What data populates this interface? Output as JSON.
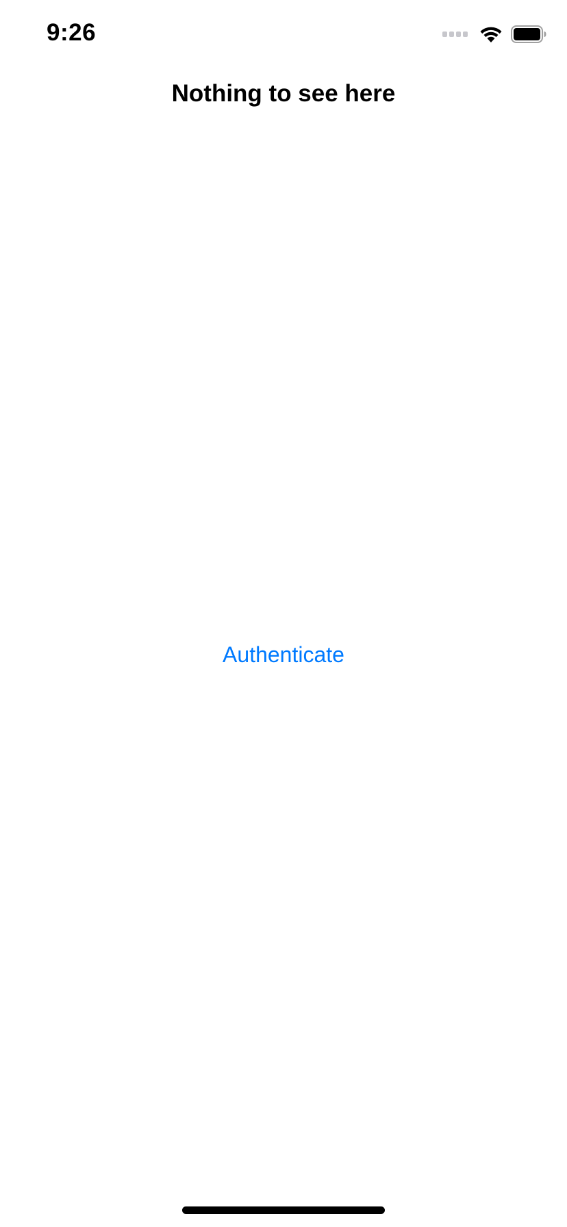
{
  "status_bar": {
    "time": "9:26",
    "icons": [
      "cellular-signal-icon",
      "wifi-icon",
      "battery-icon"
    ],
    "signal_color": "#c7c7cc"
  },
  "page": {
    "title": "Nothing to see here"
  },
  "actions": {
    "authenticate_label": "Authenticate"
  },
  "colors": {
    "accent": "#007aff",
    "background": "#ffffff",
    "text": "#000000"
  }
}
